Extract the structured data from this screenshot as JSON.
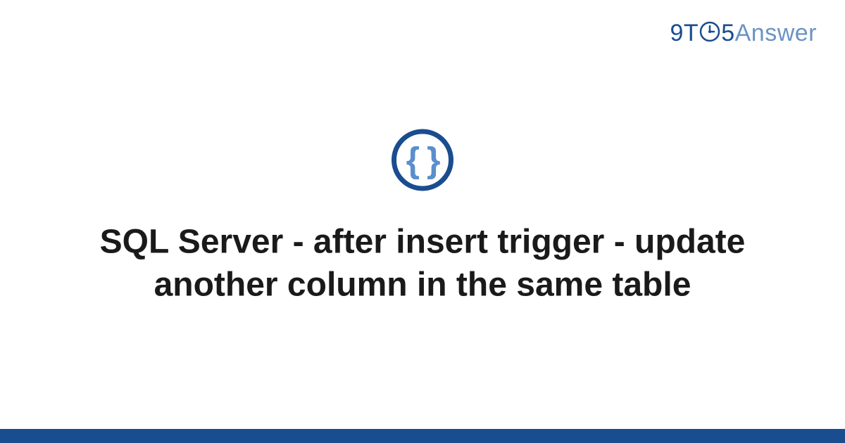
{
  "logo": {
    "part1": "9T",
    "part2": "5",
    "part3": "Answer"
  },
  "main": {
    "icon_name": "braces-icon",
    "braces": "{ }",
    "title": "SQL Server - after insert trigger - update another column in the same table"
  },
  "colors": {
    "brand_dark": "#1a4d8f",
    "brand_light": "#6b93c4",
    "text": "#1a1a1a"
  }
}
